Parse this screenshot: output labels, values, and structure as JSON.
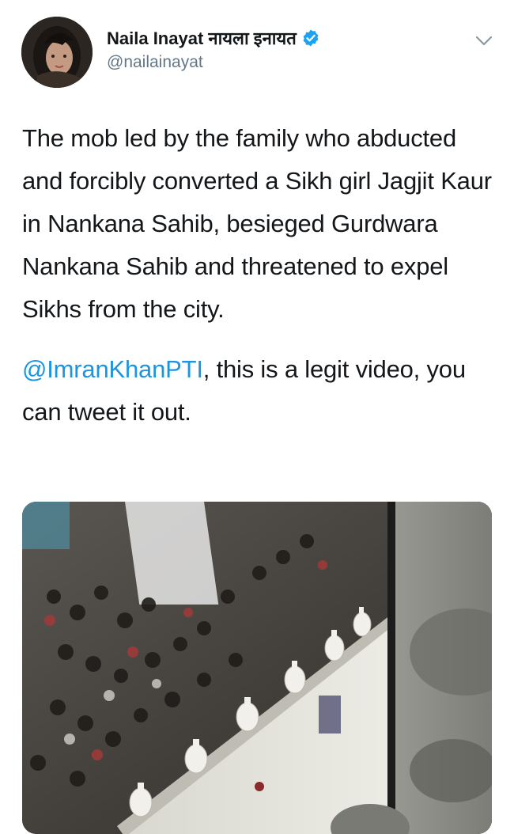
{
  "author": {
    "display_name": "Naila Inayat नायला इनायत",
    "handle": "@nailainayat",
    "verified": true,
    "avatar_icon": "profile-photo"
  },
  "tweet": {
    "paragraph1": "The mob led by the family who abducted and forcibly converted a Sikh girl Jagjit Kaur in Nankana Sahib, besieged Gurdwara Nankana Sahib and threatened to expel Sikhs from the city.",
    "mention": "@ImranKhanPTI",
    "paragraph2_rest": ", this is a legit video, you can tweet it out."
  },
  "media": {
    "type": "video-thumbnail",
    "icon": "video-still"
  },
  "colors": {
    "link": "#1b95e0",
    "verified": "#1da1f2",
    "text": "#14171a",
    "secondary": "#657786"
  },
  "icons": {
    "menu": "chevron-down-icon",
    "verified": "verified-badge-icon"
  }
}
